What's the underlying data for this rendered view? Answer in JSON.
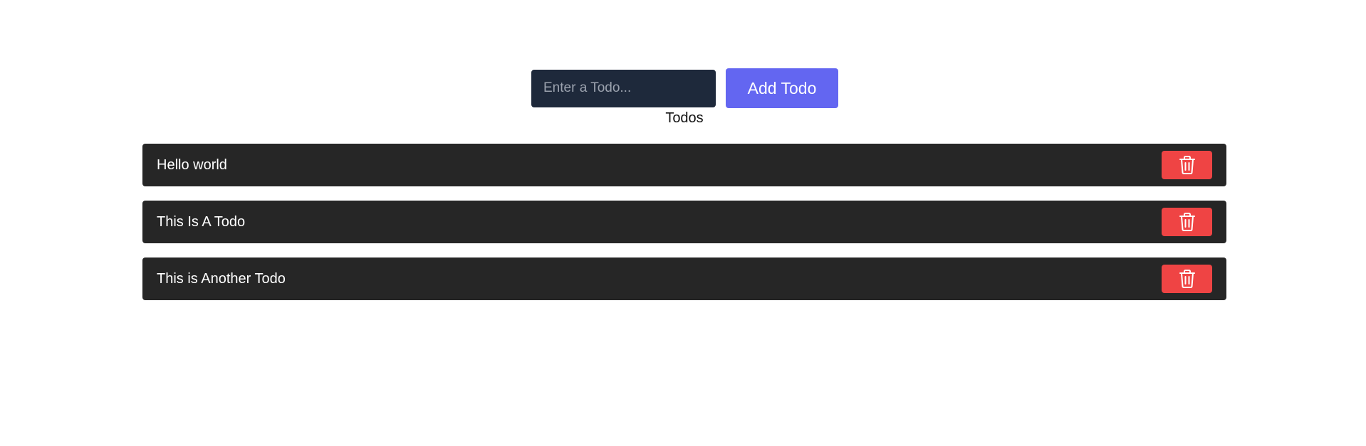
{
  "form": {
    "input_placeholder": "Enter a Todo...",
    "input_value": "",
    "add_button_label": "Add Todo"
  },
  "list": {
    "heading": "Todos",
    "items": [
      {
        "text": "Hello world",
        "delete_icon": "trash-icon"
      },
      {
        "text": "This Is A Todo",
        "delete_icon": "trash-icon"
      },
      {
        "text": "This is Another Todo",
        "delete_icon": "trash-icon"
      }
    ]
  },
  "colors": {
    "input_bg": "#1e293b",
    "accent": "#6366f1",
    "item_bg": "#262626",
    "delete": "#ef4444"
  }
}
